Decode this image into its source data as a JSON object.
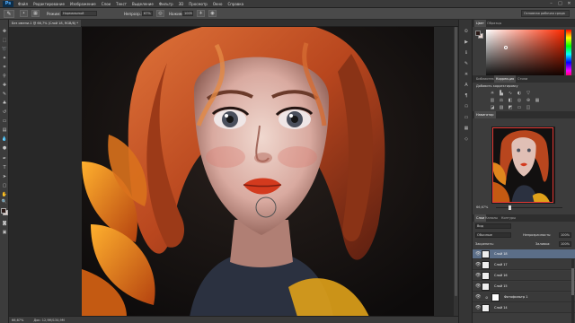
{
  "menubar": {
    "logo": "Ps",
    "items": [
      "Файл",
      "Редактирование",
      "Изображение",
      "Слои",
      "Текст",
      "Выделение",
      "Фильтр",
      "3D",
      "Просмотр",
      "Окно",
      "Справка"
    ],
    "window_controls": [
      "–",
      "□",
      "✕"
    ]
  },
  "options": {
    "mode_label": "Режим:",
    "mode_value": "Нормальный",
    "opacity_label": "Непрозр.:",
    "opacity_value": "67%",
    "pressure_label": "Нажим:",
    "pressure_value": "100%",
    "workspace": "Основная рабочая среда"
  },
  "document": {
    "tab_title": "Без имени-1 @ 66,7% (Слой 18, RGB/8) *",
    "status_zoom": "66,67%",
    "status_doc": "Док: 12,9M/134,9M"
  },
  "panels": {
    "color_tabs": [
      "Цвет",
      "Образцы"
    ],
    "adjust_tabs": [
      "Библиотеки",
      "Коррекция",
      "Стили"
    ],
    "adjust_title": "Добавить корректировку",
    "navigator_tab": "Навигатор",
    "navigator_zoom": "66,67%",
    "layer_tabs": [
      "Слои",
      "Каналы",
      "Контуры"
    ],
    "kind_label": "Вид",
    "blend_mode": "Обычные",
    "opacity_label": "Непрозрачность:",
    "opacity_value": "100%",
    "lock_label": "Закрепить:",
    "fill_label": "Заливка:",
    "fill_value": "100%",
    "layers": [
      {
        "name": "Слой 18",
        "selected": true,
        "visible": true
      },
      {
        "name": "Слой 17",
        "selected": false,
        "visible": true
      },
      {
        "name": "Слой 16",
        "selected": false,
        "visible": true
      },
      {
        "name": "Слой 15",
        "selected": false,
        "visible": true
      },
      {
        "name": "Фотофильтр 1",
        "selected": false,
        "visible": true,
        "adjustment": true
      },
      {
        "name": "Слой 14",
        "selected": false,
        "visible": true
      }
    ]
  },
  "colors": {
    "foreground": "#2b1a17",
    "background": "#e9d7d2",
    "selection": "#5b6e88",
    "nav_frame": "#e53935"
  }
}
